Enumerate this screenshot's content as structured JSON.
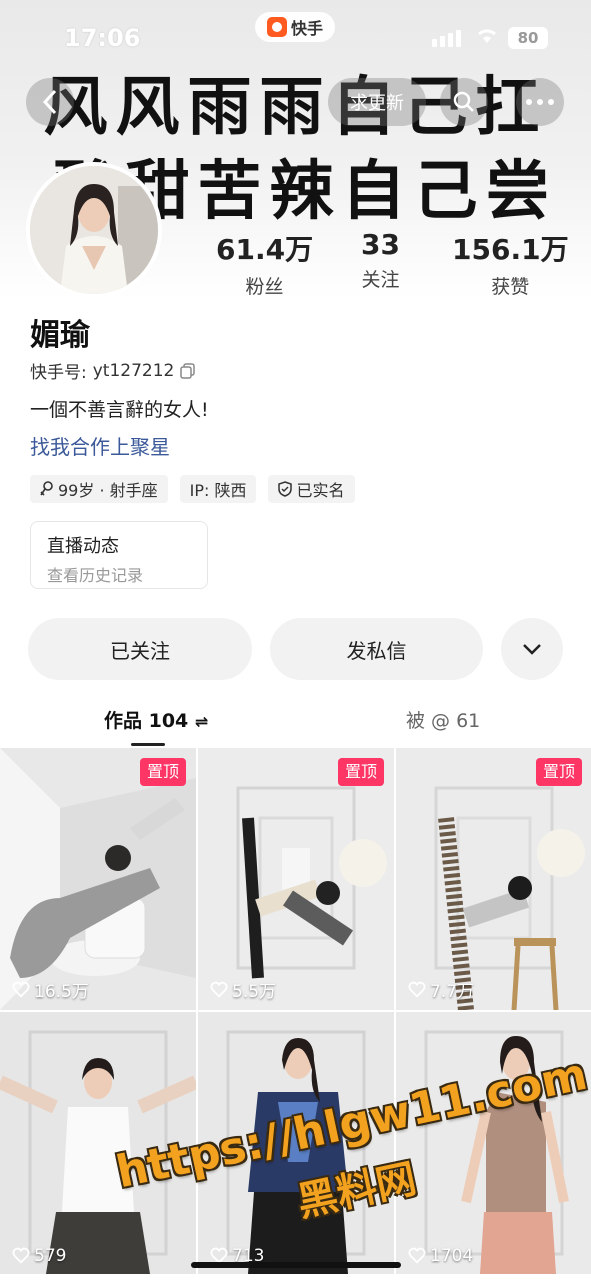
{
  "status_bar": {
    "time": "17:06",
    "app_name": "快手",
    "battery": "80"
  },
  "banner": {
    "line1": "风风雨雨自己扛",
    "line2": "酸甜苦辣自己尝"
  },
  "nav": {
    "update_label": "求更新"
  },
  "profile": {
    "stats": [
      {
        "value": "61.4万",
        "label": "粉丝"
      },
      {
        "value": "33",
        "label": "关注"
      },
      {
        "value": "156.1万",
        "label": "获赞"
      }
    ],
    "name": "媚瑜",
    "kuaishou_id_label": "快手号:",
    "kuaishou_id": "yt127212",
    "bio": "一個不善言辭的女人!",
    "cooperation": "找我合作上聚星",
    "tags": {
      "age": "99岁 · 射手座",
      "ip": "IP:  陕西",
      "verified": "已实名"
    },
    "live": {
      "title": "直播动态",
      "subtitle": "查看历史记录"
    }
  },
  "actions": {
    "follow": "已关注",
    "message": "发私信"
  },
  "tabs": {
    "works": "作品 104",
    "mentions": "被 @ 61"
  },
  "grid": [
    {
      "likes": "16.5万",
      "pinned": "置顶"
    },
    {
      "likes": "5.5万",
      "pinned": "置顶"
    },
    {
      "likes": "7.7万",
      "pinned": "置顶"
    },
    {
      "likes": "579"
    },
    {
      "likes": "713"
    },
    {
      "likes": "1704"
    }
  ],
  "watermark": {
    "url": "https://hlgw11.com",
    "site": "黑料网"
  },
  "colors": {
    "pin": "#fe3666",
    "link": "#3c5a9a",
    "watermark": "#f2a21e"
  }
}
